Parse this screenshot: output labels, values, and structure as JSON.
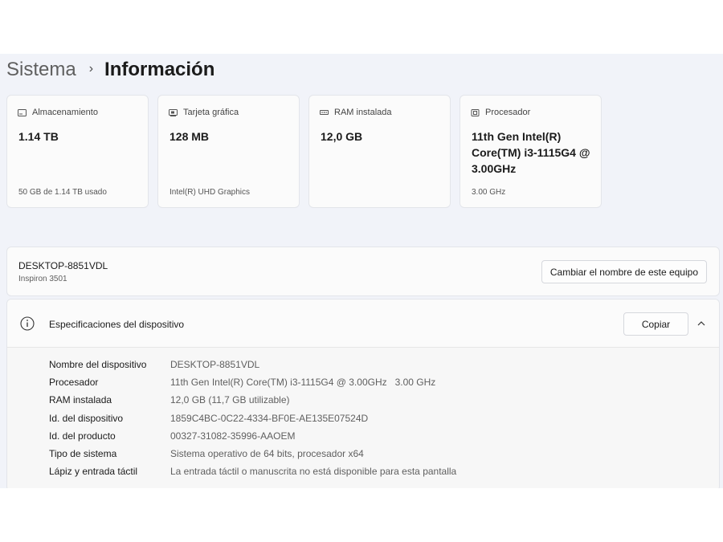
{
  "breadcrumb": {
    "parent": "Sistema",
    "separator": "›",
    "current": "Información"
  },
  "cards": [
    {
      "icon": "storage-icon",
      "label": "Almacenamiento",
      "value": "1.14 TB",
      "sub": "50 GB de 1.14 TB usado"
    },
    {
      "icon": "gpu-icon",
      "label": "Tarjeta gráfica",
      "value": "128 MB",
      "sub": "Intel(R) UHD Graphics"
    },
    {
      "icon": "ram-icon",
      "label": "RAM instalada",
      "value": "12,0 GB",
      "sub": ""
    },
    {
      "icon": "processor-icon",
      "label": "Procesador",
      "value": "11th Gen Intel(R) Core(TM) i3-1115G4 @ 3.00GHz",
      "sub": "3.00 GHz"
    }
  ],
  "device": {
    "name": "DESKTOP-8851VDL",
    "model": "Inspiron 3501",
    "rename_label": "Cambiar el nombre de este equipo"
  },
  "specs": {
    "title": "Especificaciones del dispositivo",
    "copy_label": "Copiar",
    "rows": [
      {
        "label": "Nombre del dispositivo",
        "value": "DESKTOP-8851VDL"
      },
      {
        "label": "Procesador",
        "value": "11th Gen Intel(R) Core(TM) i3-1115G4 @ 3.00GHz   3.00 GHz"
      },
      {
        "label": "RAM instalada",
        "value": "12,0 GB (11,7 GB utilizable)"
      },
      {
        "label": "Id. del dispositivo",
        "value": "1859C4BC-0C22-4334-BF0E-AE135E07524D"
      },
      {
        "label": "Id. del producto",
        "value": "00327-31082-35996-AAOEM"
      },
      {
        "label": "Tipo de sistema",
        "value": "Sistema operativo de 64 bits, procesador x64"
      },
      {
        "label": "Lápiz y entrada táctil",
        "value": "La entrada táctil o manuscrita no está disponible para esta pantalla"
      }
    ]
  },
  "colors": {
    "background": "#f1f3f9",
    "card": "#fbfbfb",
    "border": "#e3e5ea"
  }
}
